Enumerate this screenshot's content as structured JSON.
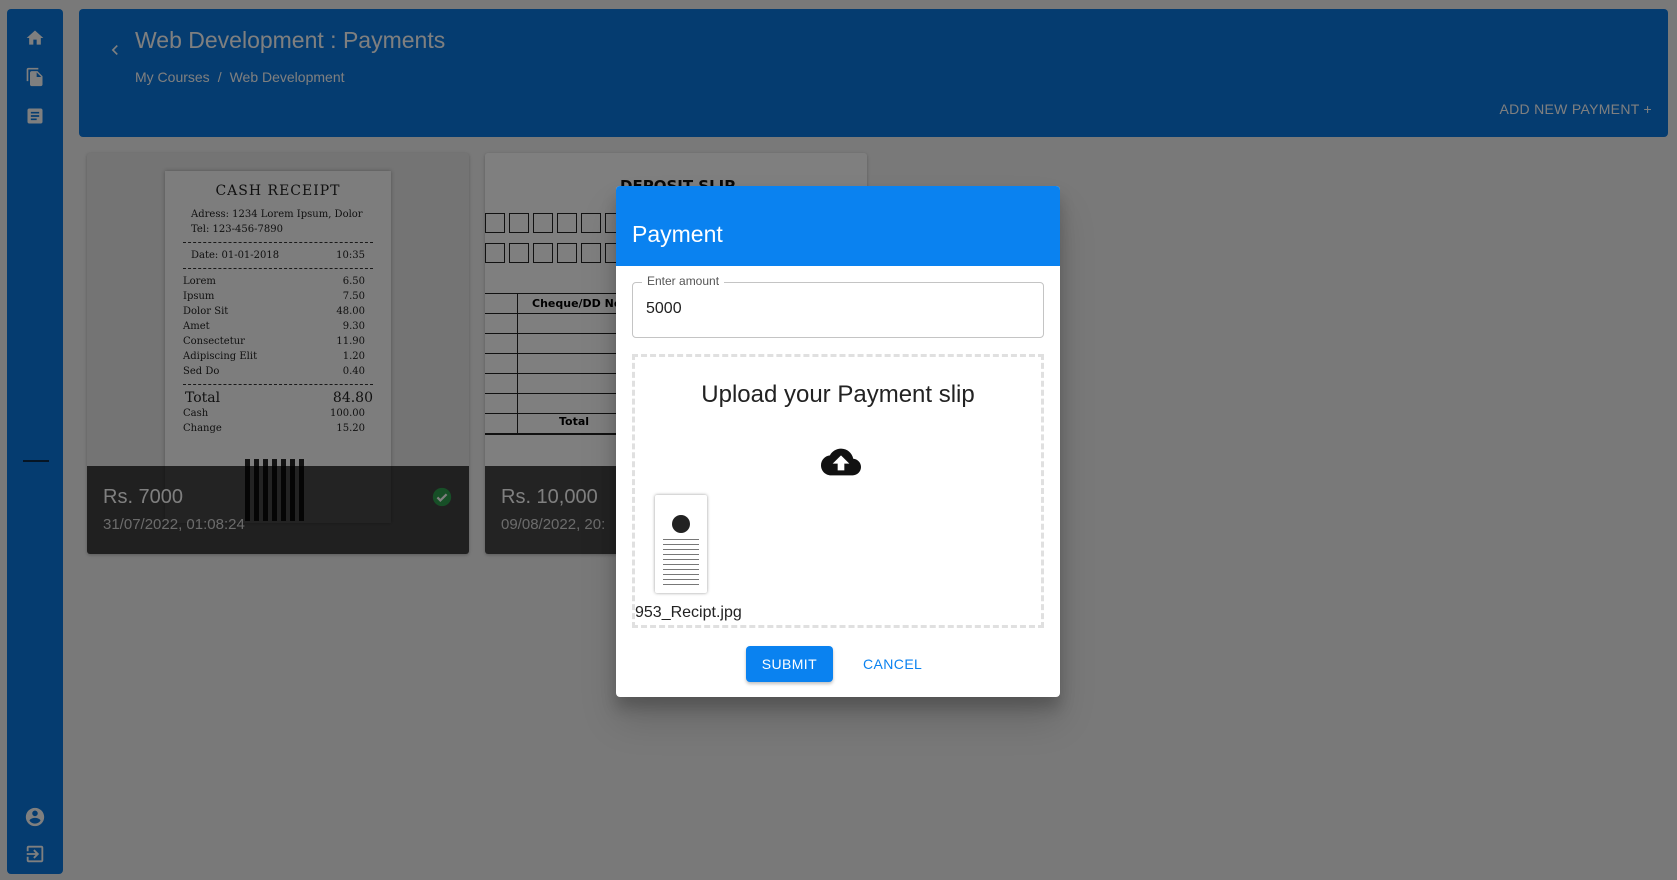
{
  "colors": {
    "primary": "#0a78e0",
    "dialog_header": "#0a82f0",
    "success": "#2e9e4f"
  },
  "sidebar": {
    "top_icons": [
      "home-icon",
      "file-copy-icon",
      "description-icon"
    ],
    "bottom_icons": [
      "account-circle-icon",
      "logout-icon"
    ]
  },
  "header": {
    "title": "Web Development : Payments",
    "breadcrumb": [
      "My Courses",
      "/",
      "Web Development"
    ],
    "add_payment_label": "ADD NEW PAYMENT +"
  },
  "cards": [
    {
      "amount": "Rs. 7000",
      "date": "31/07/2022, 01:08:24",
      "verified": true,
      "receipt": {
        "title": "CASH RECEIPT",
        "address": "Adress: 1234 Lorem Ipsum, Dolor",
        "tel": "Tel: 123-456-7890",
        "date_label": "Date: 01-01-2018",
        "time": "10:35",
        "items": [
          {
            "name": "Lorem",
            "price": "6.50"
          },
          {
            "name": "Ipsum",
            "price": "7.50"
          },
          {
            "name": "Dolor Sit",
            "price": "48.00"
          },
          {
            "name": "Amet",
            "price": "9.30"
          },
          {
            "name": "Consectetur",
            "price": "11.90"
          },
          {
            "name": "Adipiscing Elit",
            "price": "1.20"
          },
          {
            "name": "Sed Do",
            "price": "0.40"
          }
        ],
        "total_label": "Total",
        "total": "84.80",
        "cash_label": "Cash",
        "cash": "100.00",
        "change_label": "Change",
        "change": "15.20"
      }
    },
    {
      "amount": "Rs. 10,000",
      "date": "09/08/2022, 20:",
      "slip": {
        "title": "DEPOSIT SLIP",
        "cheque_header": "Cheque/DD No.",
        "total_label": "Total"
      }
    }
  ],
  "dialog": {
    "title": "Payment",
    "amount_label": "Enter amount",
    "amount_value": "5000",
    "upload_title": "Upload your Payment slip",
    "file_name": "953_Recipt.jpg",
    "submit_label": "SUBMIT",
    "cancel_label": "CANCEL"
  }
}
